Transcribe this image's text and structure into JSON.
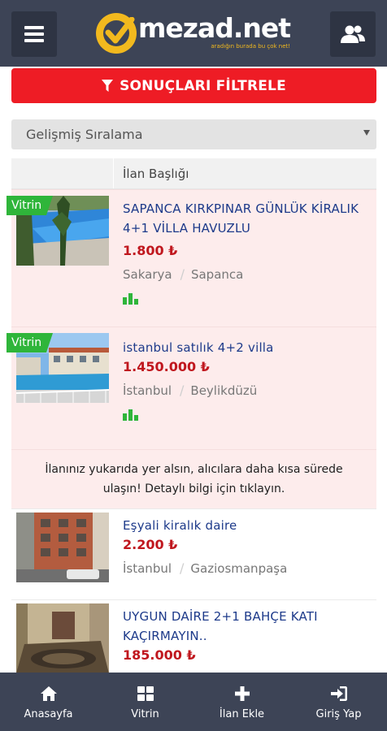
{
  "header": {
    "logo_name": "mezad.net",
    "logo_tagline": "aradığın burada bu çok net!"
  },
  "filter_button": {
    "label": "SONUÇLARI FİLTRELE"
  },
  "sort": {
    "selected": "Gelişmiş Sıralama"
  },
  "table": {
    "column_title": "İlan Başlığı"
  },
  "listings": [
    {
      "badge": "Vitrin",
      "title": "SAPANCA KIRKPINAR GÜNLÜK KİRALIK 4+1 VİLLA HAVUZLU",
      "price": "1.800 ₺",
      "city": "Sakarya",
      "district": "Sapanca",
      "stats_icon": "bar-chart-icon"
    },
    {
      "badge": "Vitrin",
      "title": "istanbul satılık 4+2 villa",
      "price": "1.450.000 ₺",
      "city": "İstanbul",
      "district": "Beylikdüzü",
      "stats_icon": "bar-chart-icon"
    },
    {
      "badge": "",
      "title": "Eşyali kiralık daire",
      "price": "2.200 ₺",
      "city": "İstanbul",
      "district": "Gaziosmanpaşa"
    },
    {
      "badge": "",
      "title": "UYGUN DAİRE 2+1 BAHÇE KATI KAÇIRMAYIN..",
      "price": "185.000 ₺"
    }
  ],
  "promo": {
    "text": "İlanınız yukarıda yer alsın, alıcılara daha kısa sürede ulaşın! Detaylı bilgi için tıklayın."
  },
  "bottom_nav": [
    {
      "label": "Anasayfa",
      "icon": "home-icon"
    },
    {
      "label": "Vitrin",
      "icon": "grid-icon"
    },
    {
      "label": "İlan Ekle",
      "icon": "plus-icon"
    },
    {
      "label": "Giriş Yap",
      "icon": "sign-in-icon"
    }
  ],
  "colors": {
    "header_bg": "#3d4456",
    "accent_red": "#ee1c25",
    "badge_green": "#2fb53a",
    "title_blue": "#1d3a8a",
    "price_red": "#c0171e",
    "highlight_row": "#fdecec"
  }
}
